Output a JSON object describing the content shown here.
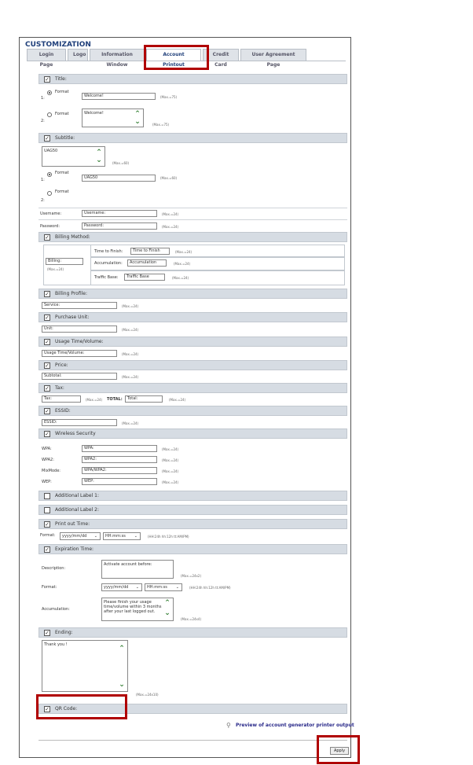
{
  "page_title": "CUSTOMIZATION",
  "tabs": [
    "Login Page",
    "Logo",
    "Information Window",
    "Account Printout",
    "Credit Card",
    "User Agreement Page"
  ],
  "sections": {
    "title": {
      "label": "Title:",
      "format_label": "Format",
      "idx1": "1:",
      "idx2": "2:",
      "value1": "Welcome!",
      "value2": "Welcome!",
      "max1": "(Max.=75)",
      "max2": "(Max.=75)"
    },
    "subtitle": {
      "label": "Subtitle:",
      "textarea": "UAG50",
      "textarea_max": "(Max.=60)",
      "format_label": "Format",
      "idx1": "1:",
      "idx2": "2:",
      "value1": "UAG50",
      "max1": "(Max.=60)"
    },
    "username": {
      "label": "Username:",
      "value": "Username:",
      "max": "(Max.=24)"
    },
    "password": {
      "label": "Password:",
      "value": "Password:",
      "max": "(Max.=24)"
    },
    "billing_method": {
      "label": "Billing Method:",
      "billing_value": "Billing:",
      "billing_max": "(Max.=24)",
      "rows": [
        {
          "label": "Time to Finish:",
          "value": "Time to Finish",
          "max": "(Max.=24)"
        },
        {
          "label": "Accumulation:",
          "value": "Accumulation",
          "max": "(Max.=24)"
        },
        {
          "label": "Traffic Base:",
          "value": "Traffic Base",
          "max": "(Max.=24)"
        }
      ]
    },
    "billing_profile": {
      "label": "Billing Profile:",
      "value": "Service:",
      "max": "(Max.=24)"
    },
    "purchase_unit": {
      "label": "Purchase Unit:",
      "value": "Unit:",
      "max": "(Max.=24)"
    },
    "usage": {
      "label": "Usage Time/Volume:",
      "value": "Usage Time/Volume:",
      "max": "(Max.=24)"
    },
    "price": {
      "label": "Price:",
      "value": "Subtotal:",
      "max": "(Max.=24)"
    },
    "tax": {
      "label": "Tax:",
      "value": "Tax:",
      "max": "(Max.=24)",
      "total_label": "TOTAL:",
      "total_value": "Total:",
      "total_max": "(Max.=24)"
    },
    "essid": {
      "label": "ESSID:",
      "value": "ESSID:",
      "max": "(Max.=24)"
    },
    "wireless": {
      "label": "Wireless Security",
      "rows": [
        {
          "label": "WPA:",
          "value": "WPA:",
          "max": "(Max.=24)"
        },
        {
          "label": "WPA2:",
          "value": "WPA2:",
          "max": "(Max.=24)"
        },
        {
          "label": "MixMode:",
          "value": "WPA/WPA2:",
          "max": "(Max.=24)"
        },
        {
          "label": "WEP:",
          "value": "WEP:",
          "max": "(Max.=24)"
        }
      ]
    },
    "additional1": {
      "label": "Additional Label 1:"
    },
    "additional2": {
      "label": "Additional Label 2:"
    },
    "print_time": {
      "label": "Print out Time:",
      "format_label": "Format:",
      "date_format": "yyyy/mm/dd",
      "time_format": "HH:mm:ss",
      "note": "(HH:24h hh:12h tt:AM/PM)"
    },
    "expiration": {
      "label": "Expiration Time:",
      "description_label": "Description:",
      "description_value": "Activate account before:",
      "description_max": "(Max.=24x2)",
      "format_label": "Format:",
      "date_format": "yyyy/mm/dd",
      "time_format": "HH:mm:ss",
      "note": "(HH:24h hh:12h tt:AM/PM)",
      "accumulation_label": "Accumulation:",
      "accumulation_value": "Please finish your usage time/volume within 3 months after your last logged out.",
      "accumulation_max": "(Max.=24x4)"
    },
    "ending": {
      "label": "Ending:",
      "value": "Thank you !",
      "max": "(Max.=24x10)"
    },
    "qr": {
      "label": "QR Code:"
    }
  },
  "preview_link": "Preview of account generator printer output",
  "apply_label": "Apply",
  "colors": {
    "highlight": "#b00000",
    "header": "#d6dce3",
    "link": "#2a2a8a",
    "title": "#1f3f7a"
  }
}
